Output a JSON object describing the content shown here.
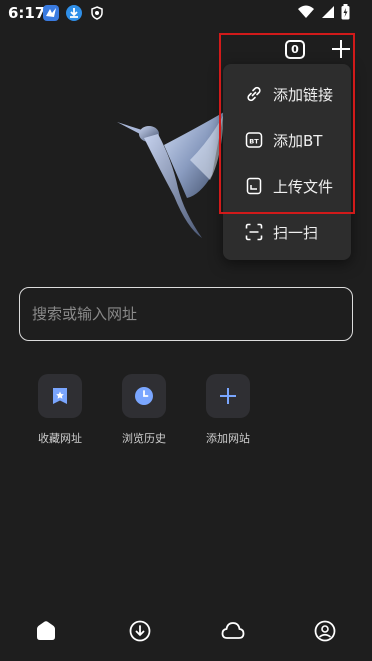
{
  "status_bar": {
    "time": "6:17",
    "app_icons": [
      "bird-app-icon",
      "download-app-icon",
      "shield-app-icon"
    ],
    "right_icons": [
      "wifi-icon",
      "signal-icon",
      "battery-charging-icon"
    ]
  },
  "header": {
    "tab_count": "0",
    "add_icon": "plus-icon"
  },
  "menu": {
    "items": [
      {
        "label": "添加链接",
        "icon": "link-icon"
      },
      {
        "label": "添加BT",
        "icon": "bt-icon"
      },
      {
        "label": "上传文件",
        "icon": "file-icon"
      },
      {
        "label": "扫一扫",
        "icon": "scan-icon"
      }
    ]
  },
  "search": {
    "placeholder": "搜索或输入网址"
  },
  "shortcuts": [
    {
      "label": "收藏网址",
      "icon": "bookmark-icon"
    },
    {
      "label": "浏览历史",
      "icon": "history-clock-icon"
    },
    {
      "label": "添加网站",
      "icon": "plus-icon"
    }
  ],
  "bottom_nav": {
    "items": [
      {
        "name": "home",
        "icon": "home-icon"
      },
      {
        "name": "downloads",
        "icon": "download-icon"
      },
      {
        "name": "cloud",
        "icon": "cloud-icon"
      },
      {
        "name": "profile",
        "icon": "profile-icon"
      }
    ]
  },
  "colors": {
    "background": "#1e1e1e",
    "menu_background": "#2d2d2d",
    "highlight_border": "#d11a1a",
    "accent_blue": "#7aa6ff"
  }
}
